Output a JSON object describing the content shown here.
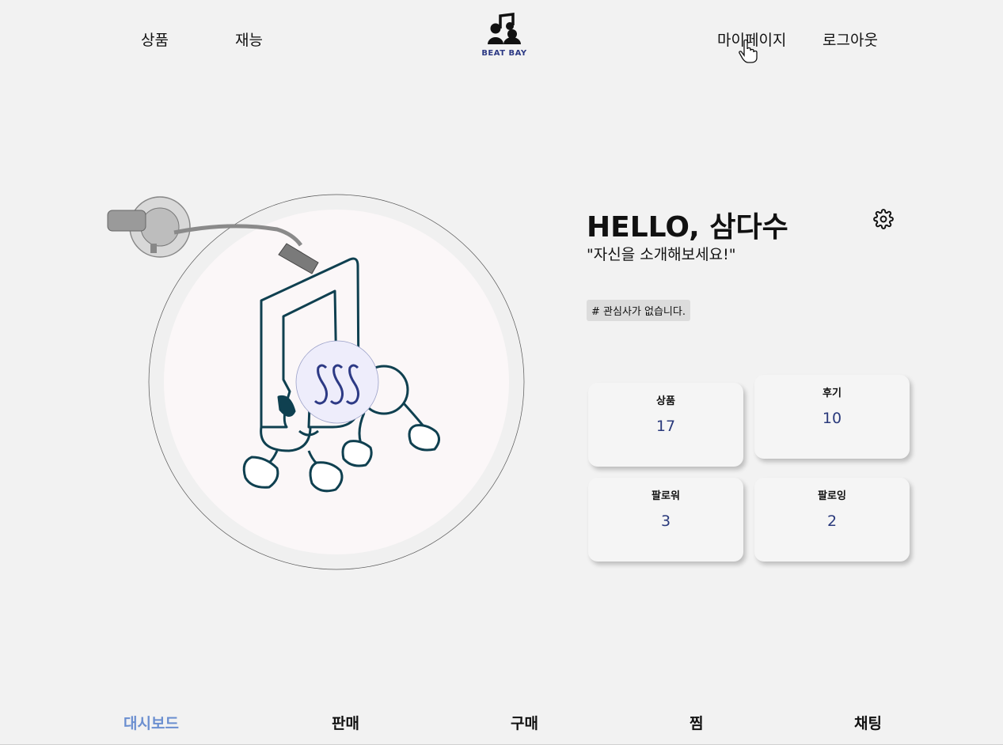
{
  "header": {
    "nav_left": [
      "상품",
      "재능"
    ],
    "logo_text": "BEAT BAY",
    "nav_right": [
      "마이페이지",
      "로그아웃"
    ]
  },
  "profile": {
    "greeting": "HELLO, 삼다수",
    "intro": "\"자신을 소개해보세요!\"",
    "interest_tag": "# 관심사가 없습니다."
  },
  "stats": [
    {
      "label": "상품",
      "value": "17"
    },
    {
      "label": "후기",
      "value": "10"
    },
    {
      "label": "팔로워",
      "value": "3"
    },
    {
      "label": "팔로잉",
      "value": "2"
    }
  ],
  "tabs": [
    "대시보드",
    "판매",
    "구매",
    "찜",
    "채팅"
  ],
  "active_tab": "대시보드",
  "colors": {
    "background": "#f2f2f2",
    "accent_blue": "#6b8fd0",
    "stat_value": "#2a3a7c",
    "logo_blue": "#2d3a85",
    "illustration": "#0f4050"
  },
  "icons": [
    "settings-gear-icon",
    "music-note-people-logo",
    "pointer-hand-cursor-icon"
  ]
}
